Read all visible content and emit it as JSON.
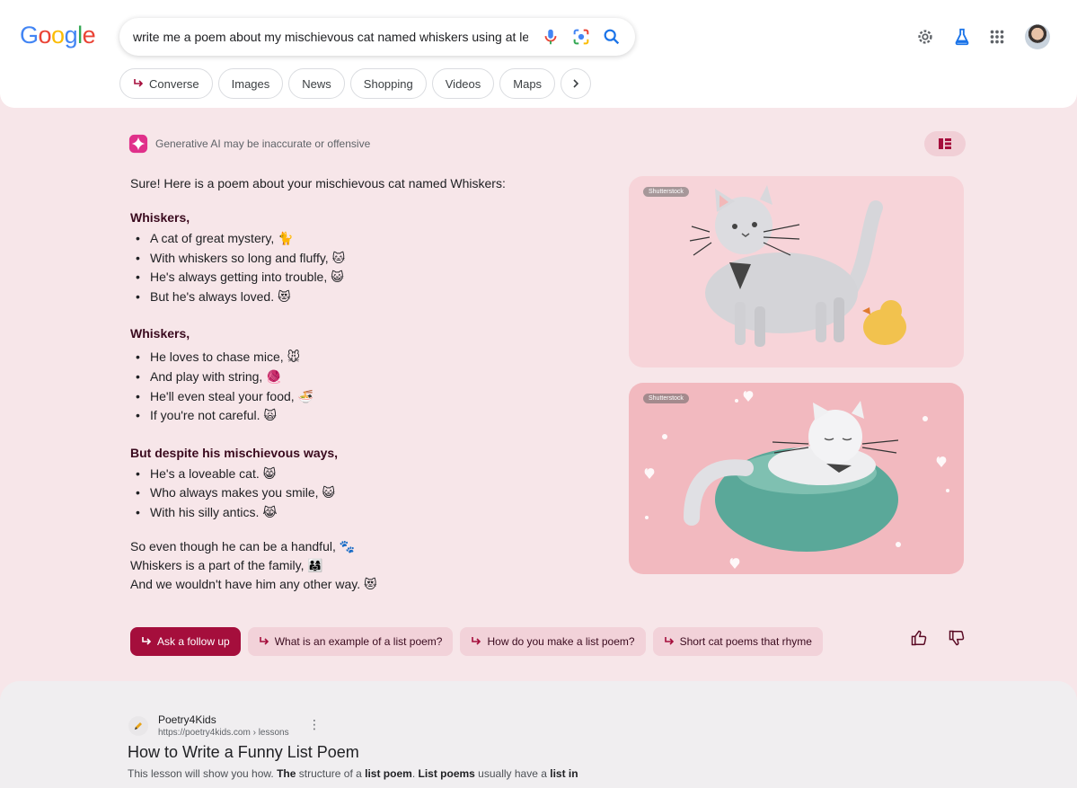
{
  "header": {
    "logo": [
      "G",
      "o",
      "o",
      "g",
      "l",
      "e"
    ],
    "search_query": "write me a poem about my mischievous cat named whiskers using at least"
  },
  "tabs": [
    {
      "label": "Converse"
    },
    {
      "label": "Images"
    },
    {
      "label": "News"
    },
    {
      "label": "Shopping"
    },
    {
      "label": "Videos"
    },
    {
      "label": "Maps"
    }
  ],
  "ai": {
    "disclaimer": "Generative AI may be inaccurate or offensive",
    "intro": "Sure! Here is a poem about your mischievous cat named Whiskers:",
    "stanzas": [
      {
        "title": "Whiskers,",
        "lines": [
          "A cat of great mystery, 🐈",
          "With whiskers so long and fluffy, 🐱",
          "He's always getting into trouble, 😺",
          "But he's always loved. 😻"
        ]
      },
      {
        "title": "Whiskers,",
        "lines": [
          "He loves to chase mice, 🐭",
          "And play with string, 🧶",
          "He'll even steal your food, 🍜",
          "If you're not careful. 🙀"
        ]
      },
      {
        "title": "But despite his mischievous ways,",
        "lines": [
          "He's a loveable cat. 😸",
          "Who always makes you smile, 😺",
          "With his silly antics. 😹"
        ]
      }
    ],
    "closing": [
      "So even though he can be a handful, 🐾",
      "Whiskers is a part of the family, 👨‍👩‍👧",
      "And we wouldn't have him any other way. 😻"
    ],
    "images": [
      {
        "source": "Shutterstock"
      },
      {
        "source": "Shutterstock"
      }
    ],
    "followups": {
      "primary": "Ask a follow up",
      "suggestions": [
        "What is an example of a list poem?",
        "How do you make a list poem?",
        "Short cat poems that rhyme"
      ]
    }
  },
  "result": {
    "site_name": "Poetry4Kids",
    "url": "https://poetry4kids.com › lessons",
    "title": "How to Write a Funny List Poem",
    "snippet_parts": [
      "This lesson will show you how. ",
      "The",
      " structure of a ",
      "list poem",
      ". ",
      "List poems",
      " usually have a ",
      "list in"
    ]
  },
  "colors": {
    "accent": "#a50e3c",
    "chip_bg": "#f2d2d9",
    "page_bg": "#f7e6e9"
  }
}
